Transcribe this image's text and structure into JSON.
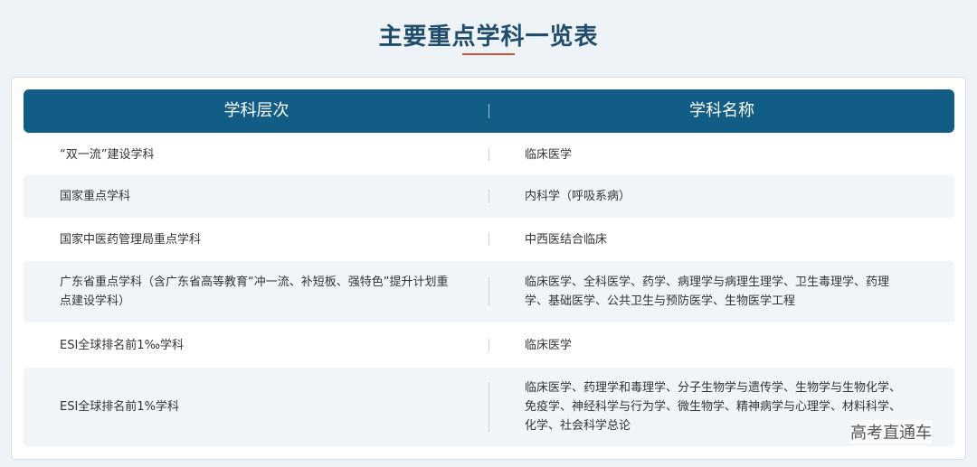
{
  "page": {
    "title": "主要重点学科一览表"
  },
  "table": {
    "headers": [
      "学科层次",
      "学科名称"
    ],
    "rows": [
      {
        "level": "“双一流”建设学科",
        "names": "临床医学"
      },
      {
        "level": "国家重点学科",
        "names": "内科学（呼吸系病）"
      },
      {
        "level": "国家中医药管理局重点学科",
        "names": "中西医结合临床"
      },
      {
        "level": "广东省重点学科（含广东省高等教育“冲一流、补短板、强特色”提升计划重点建设学科）",
        "names": "临床医学、全科医学、药学、病理学与病理生理学、卫生毒理学、药理学、基础医学、公共卫生与预防医学、生物医学工程"
      },
      {
        "level": "ESI全球排名前1‰学科",
        "names": "临床医学"
      },
      {
        "level": "ESI全球排名前1%学科",
        "names": "临床医学、药理学和毒理学、分子生物学与遗传学、生物学与生物化学、免疫学、神经科学与行为学、微生物学、精神病学与心理学、材料科学、化学、社会科学总论"
      }
    ]
  },
  "watermark": "高考直通车",
  "colors": {
    "header_bg": "#125d85",
    "title": "#1f4d6b",
    "accent_underline": "#c8563a",
    "shaded_row": "#f2f5f8"
  }
}
